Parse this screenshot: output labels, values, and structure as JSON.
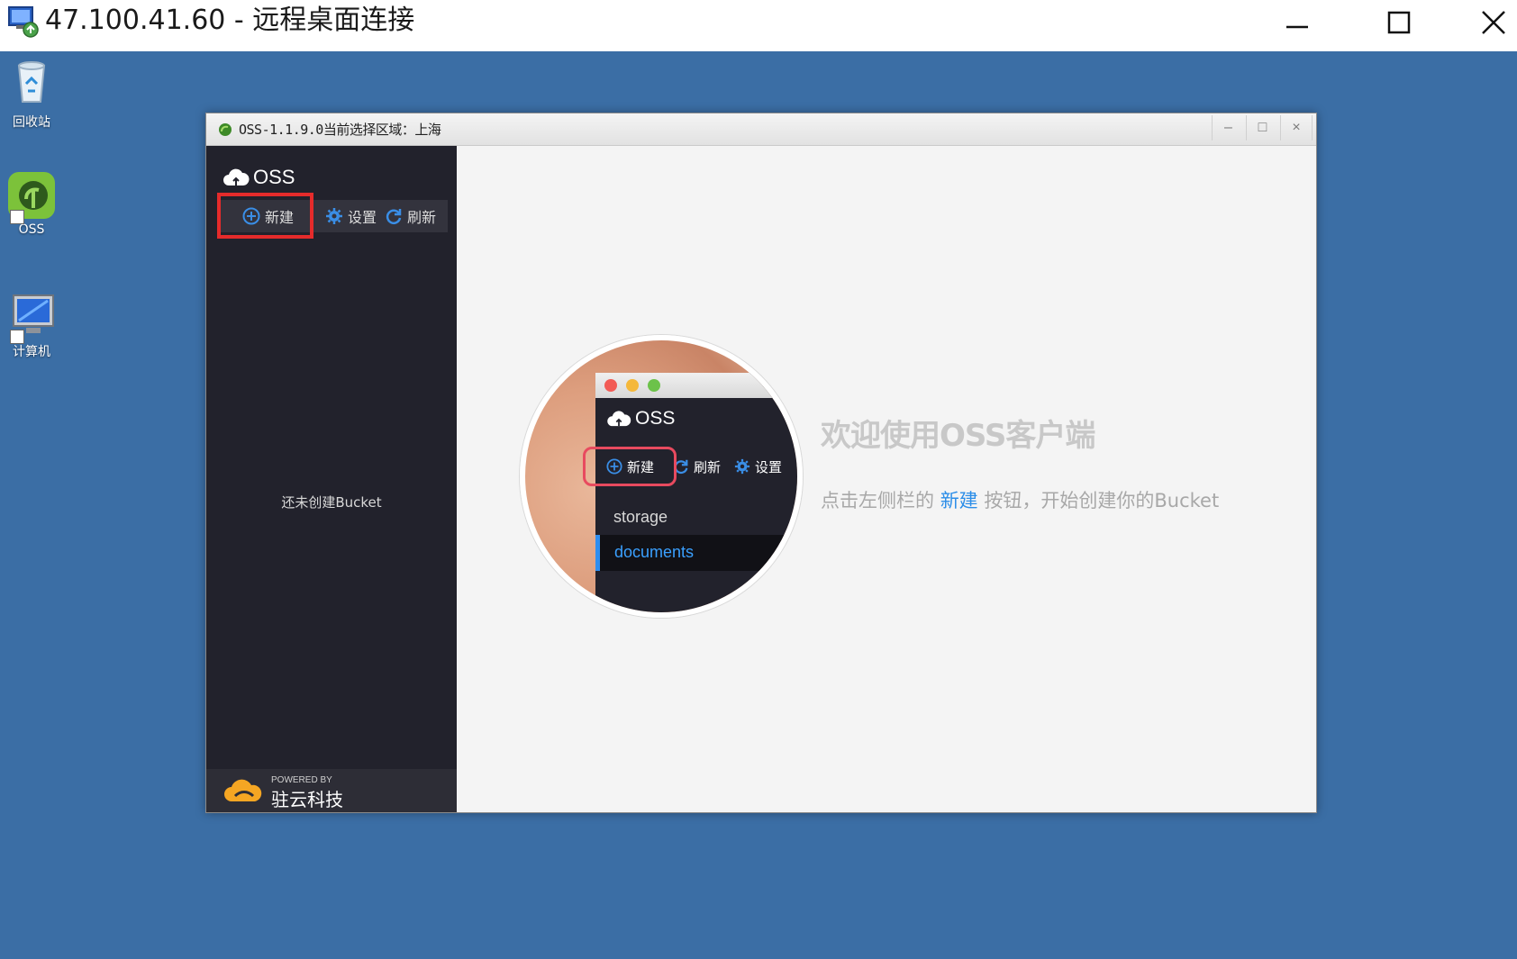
{
  "rdp": {
    "title": "47.100.41.60 - 远程桌面连接",
    "minimize_icon": "minimize-icon",
    "maximize_icon": "maximize-icon",
    "close_icon": "close-icon"
  },
  "desktop": {
    "background_color": "#3b6ea5",
    "icons": [
      {
        "label": "回收站",
        "icon": "recycle-bin-icon"
      },
      {
        "label": "OSS",
        "icon": "oss-cloud-icon"
      },
      {
        "label": "计算机",
        "icon": "computer-icon"
      }
    ]
  },
  "app": {
    "title": "OSS-1.1.9.0当前选择区域：上海",
    "controls": {
      "minimize": "–",
      "maximize": "□",
      "close": "×"
    },
    "sidebar": {
      "logo_text": "OSS",
      "toolbar": {
        "new_label": "新建",
        "settings_label": "设置",
        "refresh_label": "刷新"
      },
      "empty_text": "还未创建Bucket",
      "footer": {
        "powered_by": "POWERED BY",
        "company": "驻云科技"
      }
    },
    "main": {
      "illustration": {
        "logo_text": "OSS",
        "new_label": "新建",
        "refresh_label": "刷新",
        "settings_label": "设置",
        "list": [
          "storage",
          "documents"
        ]
      },
      "welcome_title": "欢迎使用OSS客户端",
      "welcome_prefix": "点击左侧栏的 ",
      "welcome_link": "新建",
      "welcome_suffix": " 按钮，开始创建你的Bucket"
    }
  },
  "colors": {
    "highlight_red": "#e52b2b",
    "accent_blue": "#2c8ee8",
    "sidebar_bg": "#22222c"
  }
}
